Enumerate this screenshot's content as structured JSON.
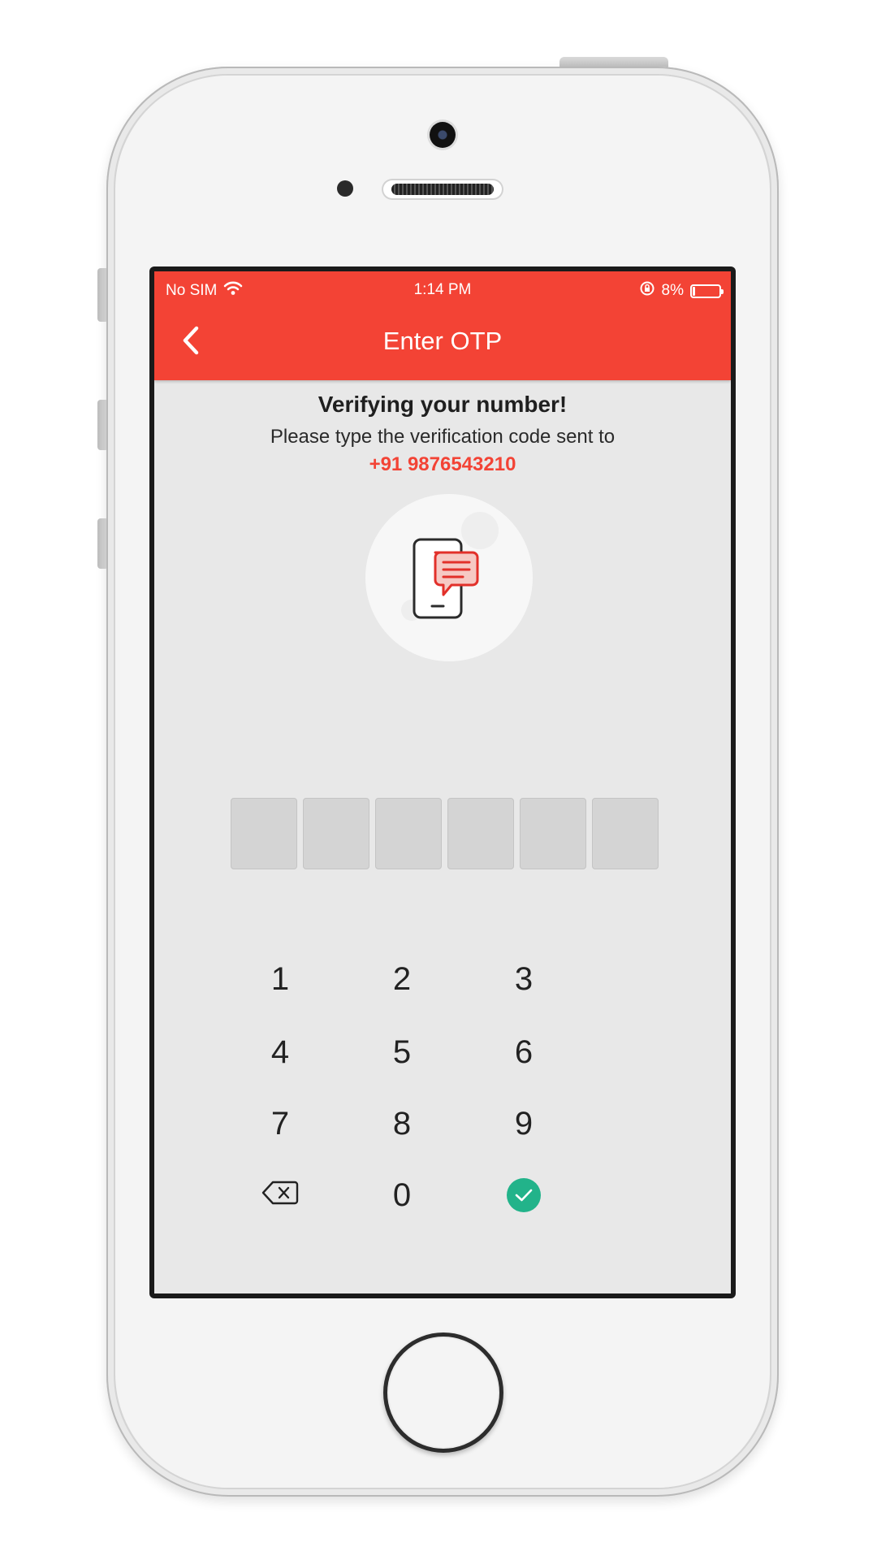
{
  "status_bar": {
    "carrier": "No SIM",
    "time": "1:14 PM",
    "battery_percent": "8%",
    "battery_level": 0.08
  },
  "nav": {
    "title": "Enter OTP",
    "back_icon": "chevron-left-icon"
  },
  "verify": {
    "title": "Verifying your number!",
    "subtitle": "Please type the verification code sent to",
    "phone_number": "+91 9876543210",
    "illustration_icon": "phone-message-icon"
  },
  "otp": {
    "length": 6,
    "values": [
      "",
      "",
      "",
      "",
      "",
      ""
    ]
  },
  "keypad": {
    "keys": [
      "1",
      "2",
      "3",
      "4",
      "5",
      "6",
      "7",
      "8",
      "9",
      "",
      "0",
      ""
    ],
    "backspace_icon": "backspace-icon",
    "confirm_icon": "check-icon"
  },
  "colors": {
    "accent": "#f34335",
    "confirm": "#22b38a",
    "background": "#e8e8e8"
  }
}
